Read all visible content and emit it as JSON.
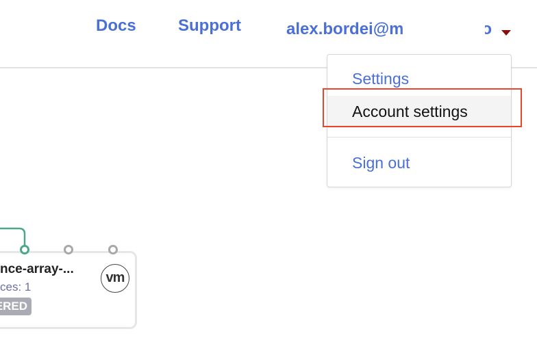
{
  "nav": {
    "docs": "Docs",
    "support": "Support",
    "user_email": "alex.bordei@m",
    "user_fragment": "o"
  },
  "dropdown": {
    "settings": "Settings",
    "account_settings": "Account settings",
    "sign_out": "Sign out"
  },
  "node": {
    "title": "nce-array-...",
    "subtitle": "ces: 1",
    "badge": "ERED",
    "logo_text": "vm"
  },
  "icons": {
    "caret": "caret-down-icon",
    "vm_logo": "vmware-logo-icon"
  },
  "colors": {
    "link": "#4a6fd6",
    "highlight": "#e8452c",
    "caret": "#8b0d0d",
    "port_active": "#4aa887",
    "port_inactive": "#a8a8a8",
    "badge": "#a9acb4"
  }
}
